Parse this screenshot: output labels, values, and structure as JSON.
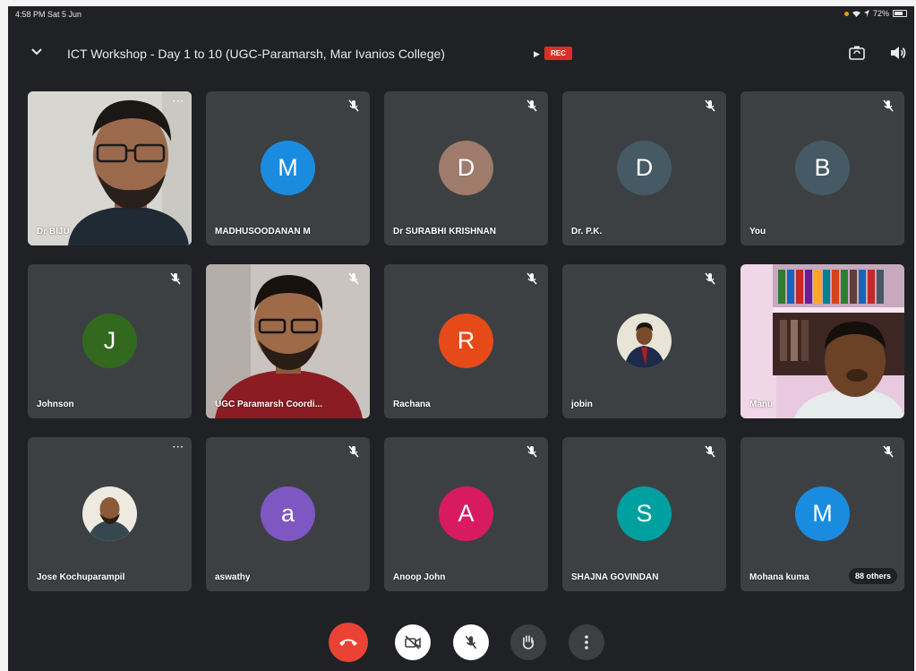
{
  "status_bar": {
    "time": "4:58 PM  Sat 5 Jun",
    "battery": "72%"
  },
  "meeting": {
    "title": "ICT Workshop - Day 1 to 10 (UGC-Paramarsh, Mar Ivanios College)",
    "rec_label": "REC"
  },
  "colors": {
    "background": "#202124",
    "tile": "#3c4043",
    "end_call": "#ea4335",
    "rec": "#d93025"
  },
  "participants": [
    {
      "name": "Dr BIJU",
      "type": "video"
    },
    {
      "name": "MADHUSOODANAN M",
      "initial": "M",
      "avatar_color": "#1a8ce0",
      "muted": true
    },
    {
      "name": "Dr SURABHI KRISHNAN",
      "initial": "D",
      "avatar_color": "#9e7b6b",
      "muted": true
    },
    {
      "name": "Dr. P.K.",
      "initial": "D",
      "avatar_color": "#455a64",
      "muted": true
    },
    {
      "name": "You",
      "initial": "B",
      "avatar_color": "#455a64",
      "muted": true
    },
    {
      "name": "Johnson",
      "initial": "J",
      "avatar_color": "#33691e",
      "muted": true
    },
    {
      "name": "UGC Paramarsh Coordi...",
      "type": "video",
      "muted": true
    },
    {
      "name": "Rachana",
      "initial": "R",
      "avatar_color": "#e64a19",
      "muted": true
    },
    {
      "name": "jobin",
      "type": "photo",
      "muted": true
    },
    {
      "name": "Manu",
      "type": "video"
    },
    {
      "name": "Jose Kochuparampil",
      "type": "photo"
    },
    {
      "name": "aswathy",
      "initial": "a",
      "avatar_color": "#7e57c2",
      "muted": true
    },
    {
      "name": "Anoop John",
      "initial": "A",
      "avatar_color": "#d81b60",
      "muted": true
    },
    {
      "name": "SHAJNA GOVINDAN",
      "initial": "S",
      "avatar_color": "#00a0a0",
      "muted": true
    },
    {
      "name": "Mohana kuma",
      "initial": "M",
      "avatar_color": "#1a8ce0",
      "muted": true,
      "others_label": "88 others"
    }
  ],
  "controls": {
    "end_call": "end-call-icon",
    "camera": "camera-off-icon",
    "mic": "mic-off-icon",
    "raise_hand": "raise-hand-icon",
    "more": "more-options-icon"
  }
}
